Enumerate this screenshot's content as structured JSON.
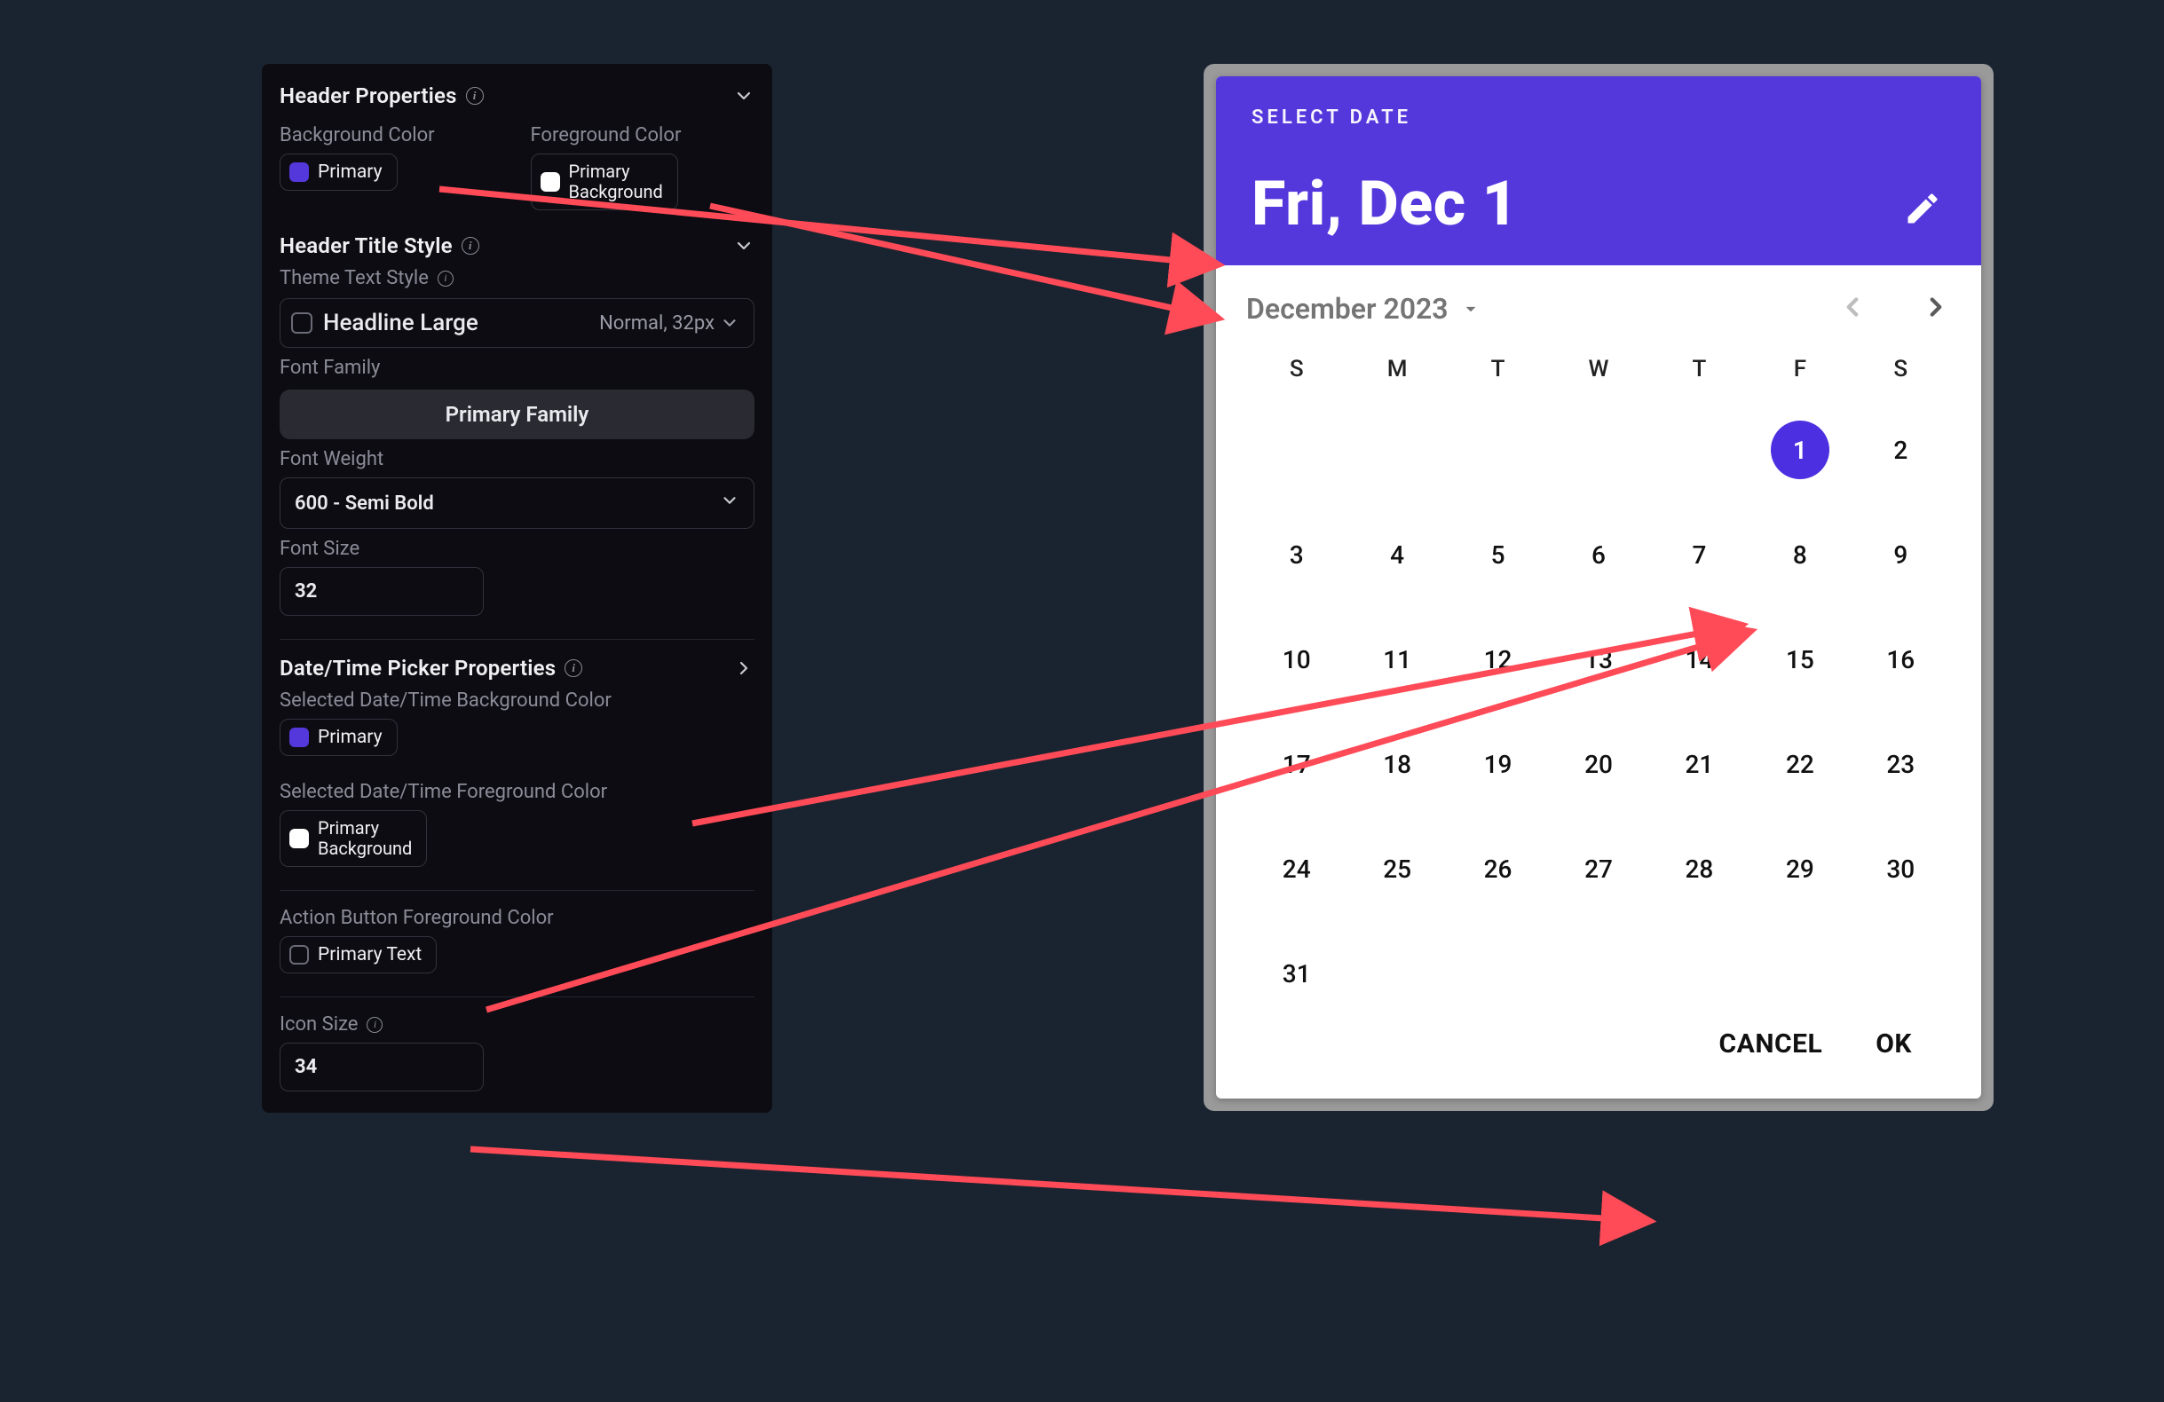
{
  "panel": {
    "headerProps": {
      "title": "Header Properties",
      "bgLabel": "Background Color",
      "fgLabel": "Foreground Color",
      "bgValue": "Primary",
      "fgValueLine1": "Primary",
      "fgValueLine2": "Background"
    },
    "headerTitleStyle": {
      "title": "Header Title Style",
      "themeTextLabel": "Theme Text Style",
      "themeTextValue": "Headline Large",
      "themeTextMeta": "Normal, 32px",
      "fontFamilyLabel": "Font Family",
      "fontFamilyValue": "Primary Family",
      "fontWeightLabel": "Font Weight",
      "fontWeightValue": "600 - Semi Bold",
      "fontSizeLabel": "Font Size",
      "fontSizeValue": "32"
    },
    "dateTimePicker": {
      "title": "Date/Time Picker Properties",
      "selBgLabel": "Selected Date/Time Background Color",
      "selBgValue": "Primary",
      "selFgLabel": "Selected Date/Time Foreground Color",
      "selFgValueLine1": "Primary",
      "selFgValueLine2": "Background",
      "actionBtnFgLabel": "Action Button Foreground Color",
      "actionBtnFgValue": "Primary Text",
      "iconSizeLabel": "Icon Size",
      "iconSizeValue": "34"
    }
  },
  "picker": {
    "selectLabel": "SELECT DATE",
    "selectedDateText": "Fri, Dec 1",
    "monthLabel": "December 2023",
    "dow": [
      "S",
      "M",
      "T",
      "W",
      "T",
      "F",
      "S"
    ],
    "weeks": [
      [
        "",
        "",
        "",
        "",
        "",
        "1",
        "2"
      ],
      [
        "3",
        "4",
        "5",
        "6",
        "7",
        "8",
        "9"
      ],
      [
        "10",
        "11",
        "12",
        "13",
        "14",
        "15",
        "16"
      ],
      [
        "17",
        "18",
        "19",
        "20",
        "21",
        "22",
        "23"
      ],
      [
        "24",
        "25",
        "26",
        "27",
        "28",
        "29",
        "30"
      ],
      [
        "31",
        "",
        "",
        "",
        "",
        "",
        ""
      ]
    ],
    "selectedDay": "1",
    "cancelLabel": "CANCEL",
    "okLabel": "OK"
  },
  "colors": {
    "primary": "#5438DC",
    "primaryBackground": "#ffffff"
  }
}
